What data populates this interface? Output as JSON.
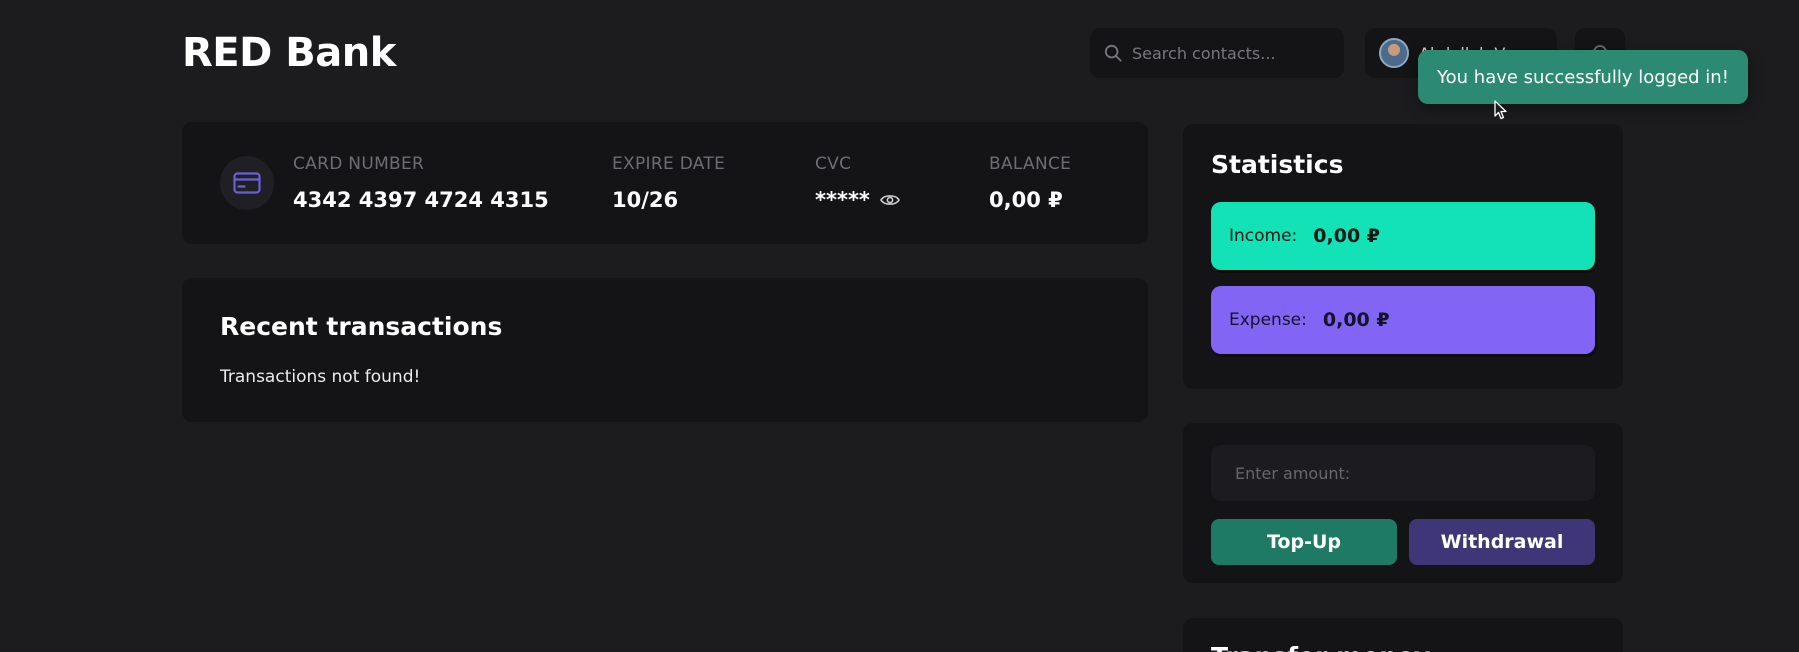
{
  "header": {
    "brand": "RED Bank",
    "search_placeholder": "Search contacts...",
    "user_name": "Abdullah V"
  },
  "toast": {
    "message": "You have successfully logged in!"
  },
  "card": {
    "number_label": "CARD NUMBER",
    "number": "4342 4397 4724 4315",
    "expire_label": "EXPIRE DATE",
    "expire": "10/26",
    "cvc_label": "CVC",
    "cvc": "*****",
    "balance_label": "BALANCE",
    "balance": "0,00 ₽"
  },
  "transactions": {
    "title": "Recent transactions",
    "empty_message": "Transactions not found!"
  },
  "statistics": {
    "title": "Statistics",
    "income_label": "Income:",
    "income_value": "0,00 ₽",
    "expense_label": "Expense:",
    "expense_value": "0,00 ₽"
  },
  "actions": {
    "amount_placeholder": "Enter amount:",
    "topup_label": "Top-Up",
    "withdraw_label": "Withdrawal"
  },
  "transfer": {
    "title": "Transfer money"
  },
  "colors": {
    "background": "#1c1c1e",
    "card": "#141416",
    "income": "#12e2b6",
    "expense": "#8265f5",
    "toast": "#2d8a72",
    "topup": "#1f7a65",
    "withdraw": "#3e3676"
  }
}
